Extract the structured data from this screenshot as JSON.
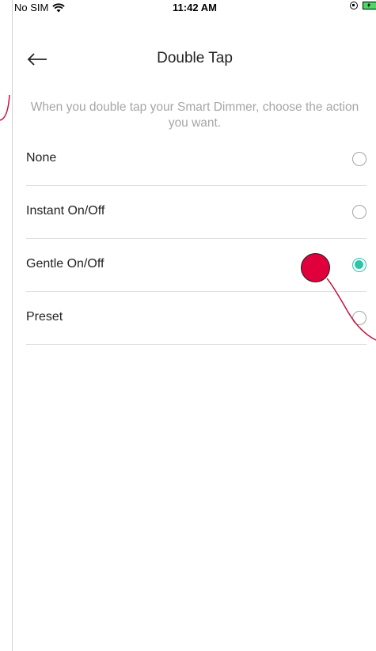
{
  "status_bar": {
    "carrier": "No SIM",
    "time": "11:42 AM"
  },
  "nav": {
    "title": "Double Tap",
    "back_icon": "arrow-left-icon"
  },
  "description": "When you double tap your Smart Dimmer, choose the action you want.",
  "options": [
    {
      "label": "None",
      "selected": false
    },
    {
      "label": "Instant On/Off",
      "selected": false
    },
    {
      "label": "Gentle On/Off",
      "selected": true
    },
    {
      "label": "Preset",
      "selected": false
    }
  ],
  "colors": {
    "accent": "#2ec4a9",
    "annotation": "#e0003c"
  }
}
